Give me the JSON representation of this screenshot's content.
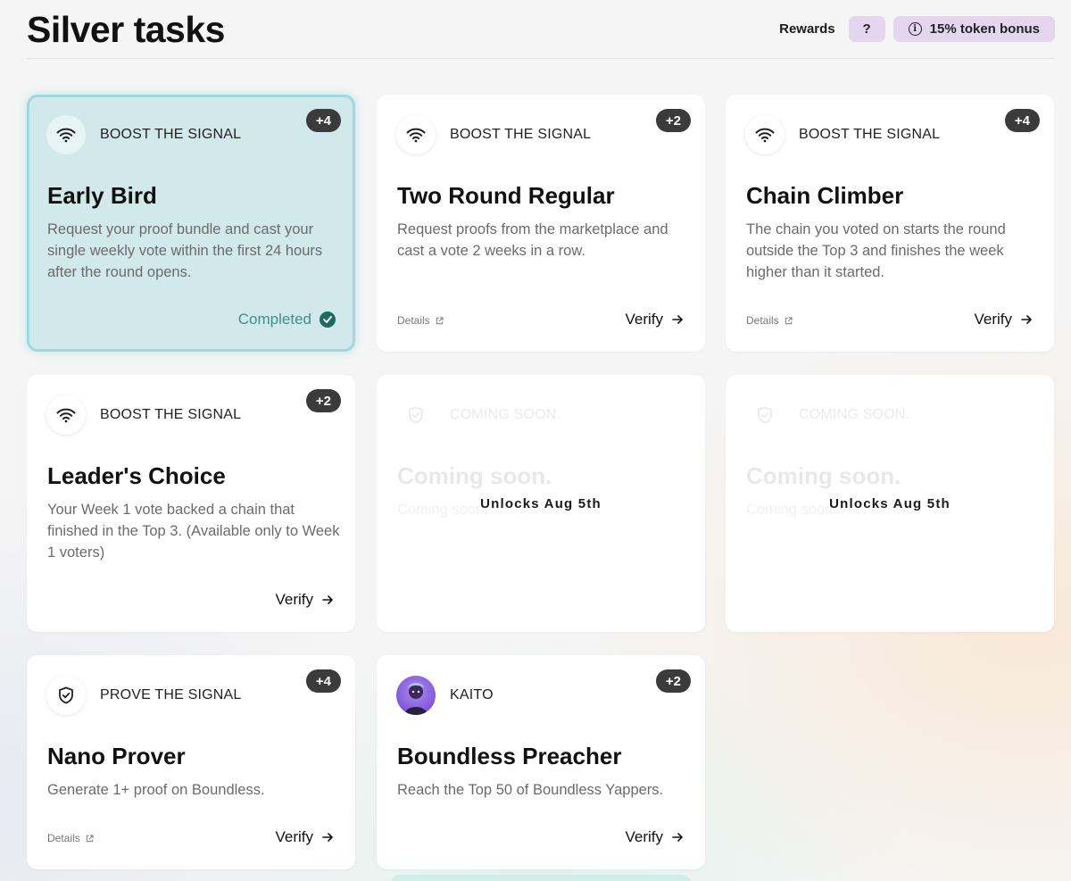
{
  "header": {
    "title": "Silver tasks",
    "rewards_label": "Rewards",
    "help_label": "?",
    "bonus_label": "15% token bonus"
  },
  "tasks": [
    {
      "category": "BOOST THE SIGNAL",
      "points": "+4",
      "title": "Early Bird",
      "description": "Request your proof bundle and cast your single weekly vote within the first 24 hours after the round opens.",
      "status": "Completed"
    },
    {
      "category": "BOOST THE SIGNAL",
      "points": "+2",
      "title": "Two Round Regular",
      "description": "Request proofs from the marketplace and cast a vote 2 weeks in a row.",
      "details_label": "Details",
      "verify_label": "Verify"
    },
    {
      "category": "BOOST THE SIGNAL",
      "points": "+4",
      "title": "Chain Climber",
      "description": "The chain you voted on starts the round outside the Top 3 and finishes the week higher than it started.",
      "details_label": "Details",
      "verify_label": "Verify"
    },
    {
      "category": "BOOST THE SIGNAL",
      "points": "+2",
      "title": "Leader's Choice",
      "description": "Your Week 1 vote backed a chain that finished in the Top 3. (Available only to Week 1 voters)",
      "verify_label": "Verify"
    },
    {
      "category": "COMING SOON.",
      "title": "Coming soon.",
      "description": "Coming soon.",
      "unlock_text": "Unlocks Aug 5th"
    },
    {
      "category": "COMING SOON.",
      "title": "Coming soon.",
      "description": "Coming soon.",
      "unlock_text": "Unlocks Aug 5th"
    },
    {
      "category": "PROVE THE SIGNAL",
      "points": "+4",
      "title": "Nano Prover",
      "description": "Generate 1+ proof on Boundless.",
      "details_label": "Details",
      "verify_label": "Verify"
    },
    {
      "category": "KAITO",
      "points": "+2",
      "title": "Boundless Preacher",
      "description": "Reach the Top 50 of Boundless Yappers.",
      "verify_label": "Verify"
    }
  ],
  "icons": {
    "boost": "wifi-icon",
    "prove": "shield-check-icon",
    "kaito": "kaito-avatar",
    "locked": "shield-icon"
  },
  "colors": {
    "accent_pill": "#e4d6ef",
    "completed_bg": "#d1e9eb",
    "completed_text": "#3f8f86",
    "points_badge": "#3b3b3b"
  }
}
